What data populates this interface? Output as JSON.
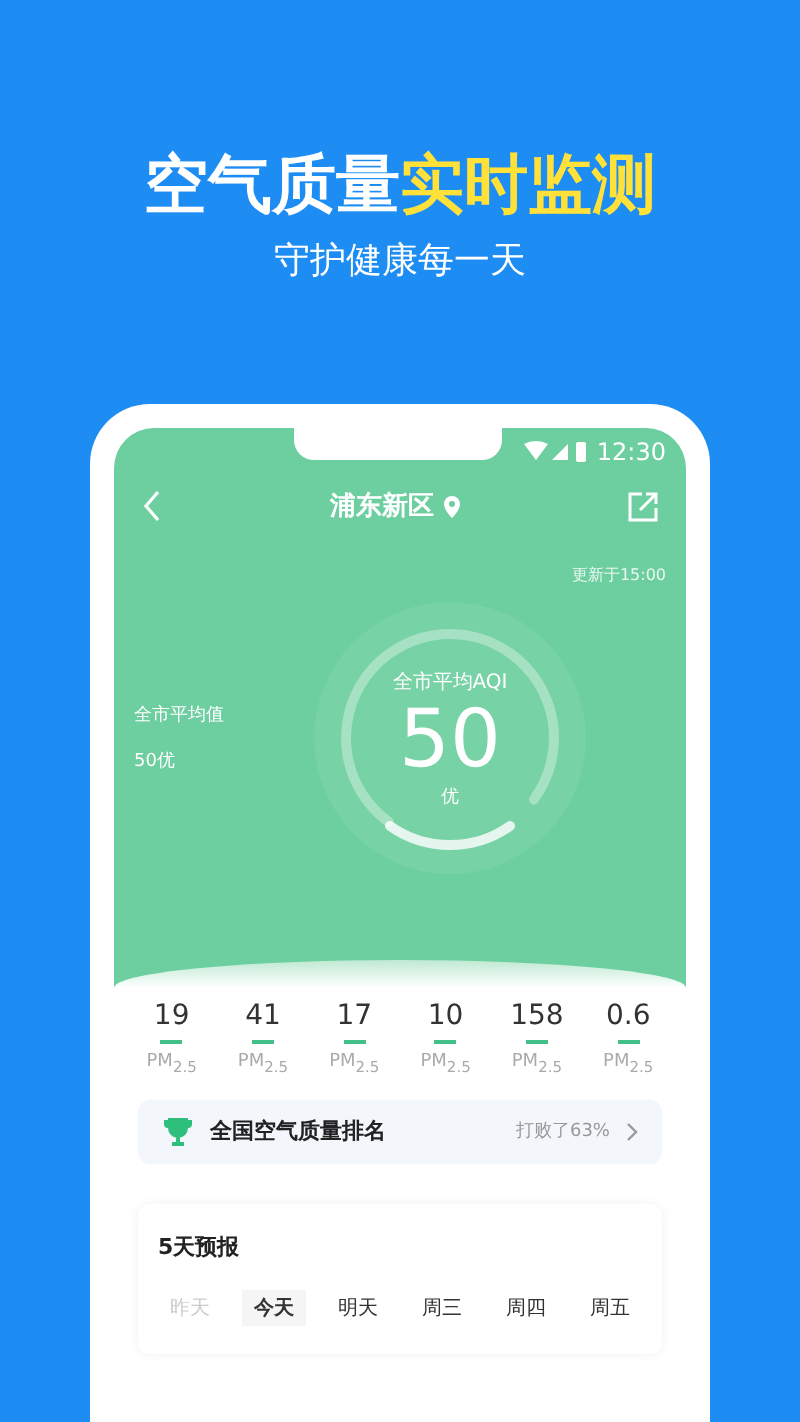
{
  "headline": [
    {
      "text": "空气质量",
      "kind": "plain"
    },
    {
      "text": "实时监测",
      "kind": "highlight"
    }
  ],
  "subtitle": "守护健康每一天",
  "status_bar": {
    "time": "12:30"
  },
  "header": {
    "title": "浦东新区"
  },
  "updated": "更新于15:00",
  "city_average": {
    "label": "全市平均值",
    "value": "50优"
  },
  "gauge": {
    "label": "全市平均AQI",
    "value": "50",
    "grade": "优"
  },
  "pollutants": [
    {
      "value": "19",
      "name": "PM$_{2.5}$"
    },
    {
      "value": "41",
      "name": "PM$_{2.5}$"
    },
    {
      "value": "17",
      "name": "PM$_{2.5}$"
    },
    {
      "value": "10",
      "name": "PM$_{2.5}$"
    },
    {
      "value": "158",
      "name": "PM$_{2.5}$"
    },
    {
      "value": "0.6",
      "name": "PM$_{2.5}$"
    }
  ],
  "ranking": {
    "title": "全国空气质量排名",
    "result": "打败了63%"
  },
  "forecast": {
    "title": "5天预报",
    "days": [
      {
        "label": "昨天",
        "selected": false,
        "disabled": true
      },
      {
        "label": "今天",
        "selected": true,
        "disabled": false
      },
      {
        "label": "明天",
        "selected": false,
        "disabled": false
      },
      {
        "label": "周三",
        "selected": false,
        "disabled": false
      },
      {
        "label": "周四",
        "selected": false,
        "disabled": false
      },
      {
        "label": "周五",
        "selected": false,
        "disabled": false
      }
    ]
  }
}
